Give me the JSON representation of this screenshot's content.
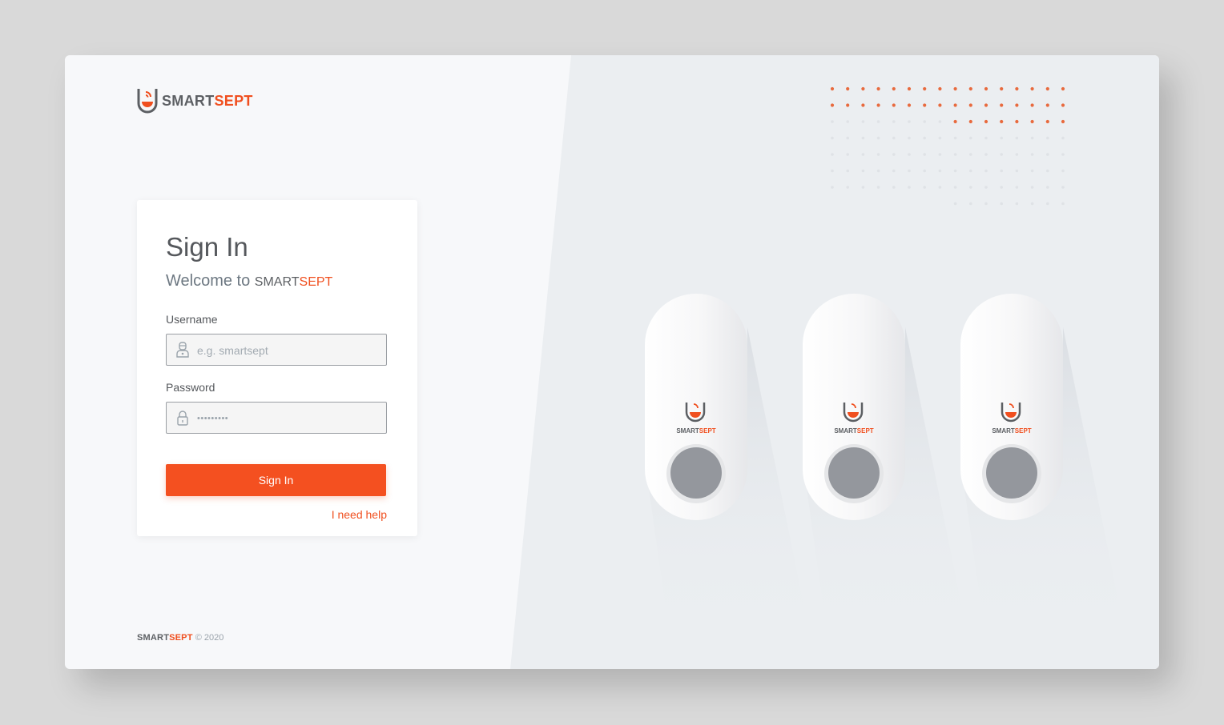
{
  "brand": {
    "part1": "SMART",
    "part2": "SEPT"
  },
  "colors": {
    "accent": "#f04f1f",
    "text_dark": "#5c5f63"
  },
  "signin": {
    "title": "Sign In",
    "welcome_prefix": "Welcome to",
    "username_label": "Username",
    "username_placeholder": "e.g. smartsept",
    "username_icon": "user-icon",
    "password_label": "Password",
    "password_value": "•••••••••",
    "password_icon": "lock-icon",
    "submit_label": "Sign In",
    "help_link": "I need help"
  },
  "footer": {
    "copyright": "© 2020"
  }
}
